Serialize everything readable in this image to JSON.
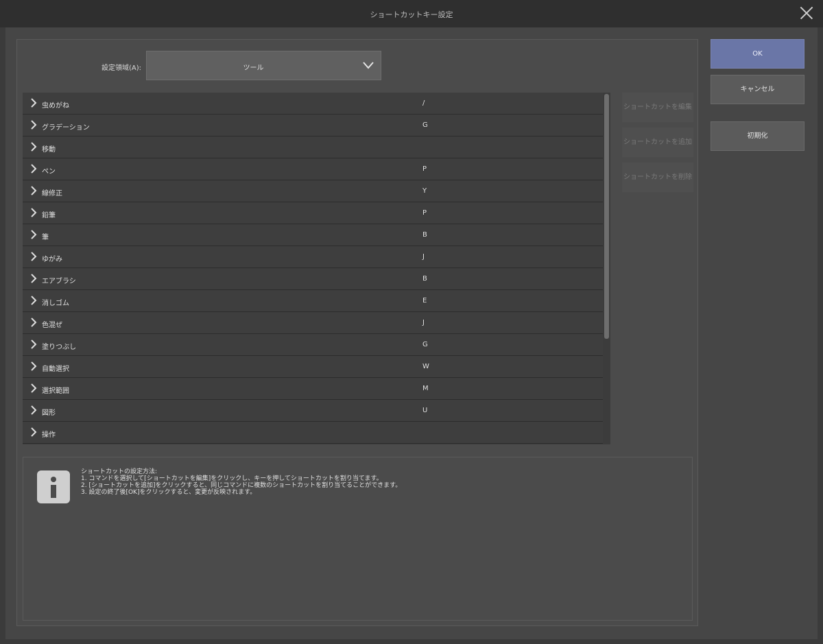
{
  "window": {
    "title": "ショートカットキー設定"
  },
  "area": {
    "label": "設定領域(A):",
    "value": "ツール"
  },
  "items": [
    {
      "name": "虫めがね",
      "key": "/"
    },
    {
      "name": "グラデーション",
      "key": "G"
    },
    {
      "name": "移動",
      "key": ""
    },
    {
      "name": "ペン",
      "key": "P"
    },
    {
      "name": "線修正",
      "key": "Y"
    },
    {
      "name": "鉛筆",
      "key": "P"
    },
    {
      "name": "筆",
      "key": "B"
    },
    {
      "name": "ゆがみ",
      "key": "J"
    },
    {
      "name": "エアブラシ",
      "key": "B"
    },
    {
      "name": "消しゴム",
      "key": "E"
    },
    {
      "name": "色混ぜ",
      "key": "J"
    },
    {
      "name": "塗りつぶし",
      "key": "G"
    },
    {
      "name": "自動選択",
      "key": "W"
    },
    {
      "name": "選択範囲",
      "key": "M"
    },
    {
      "name": "図形",
      "key": "U"
    },
    {
      "name": "操作",
      "key": ""
    }
  ],
  "side_buttons": {
    "edit": "ショートカットを編集",
    "add": "ショートカットを追加",
    "delete": "ショートカットを削除"
  },
  "buttons": {
    "ok": "OK",
    "cancel": "キャンセル",
    "reset": "初期化"
  },
  "info": {
    "title": "ショートカットの設定方法:",
    "lines": [
      "1. コマンドを選択して[ショートカットを編集]をクリックし、キーを押してショートカットを割り当てます。",
      "2. [ショートカットを追加]をクリックすると、同じコマンドに複数のショートカットを割り当てることができます。",
      "3. 設定の終了後[OK]をクリックすると、変更が反映されます。"
    ]
  },
  "icons": {
    "close": "close-icon",
    "dropdown": "chevron-down-icon",
    "expand": "chevron-right-icon",
    "info": "info-icon"
  }
}
